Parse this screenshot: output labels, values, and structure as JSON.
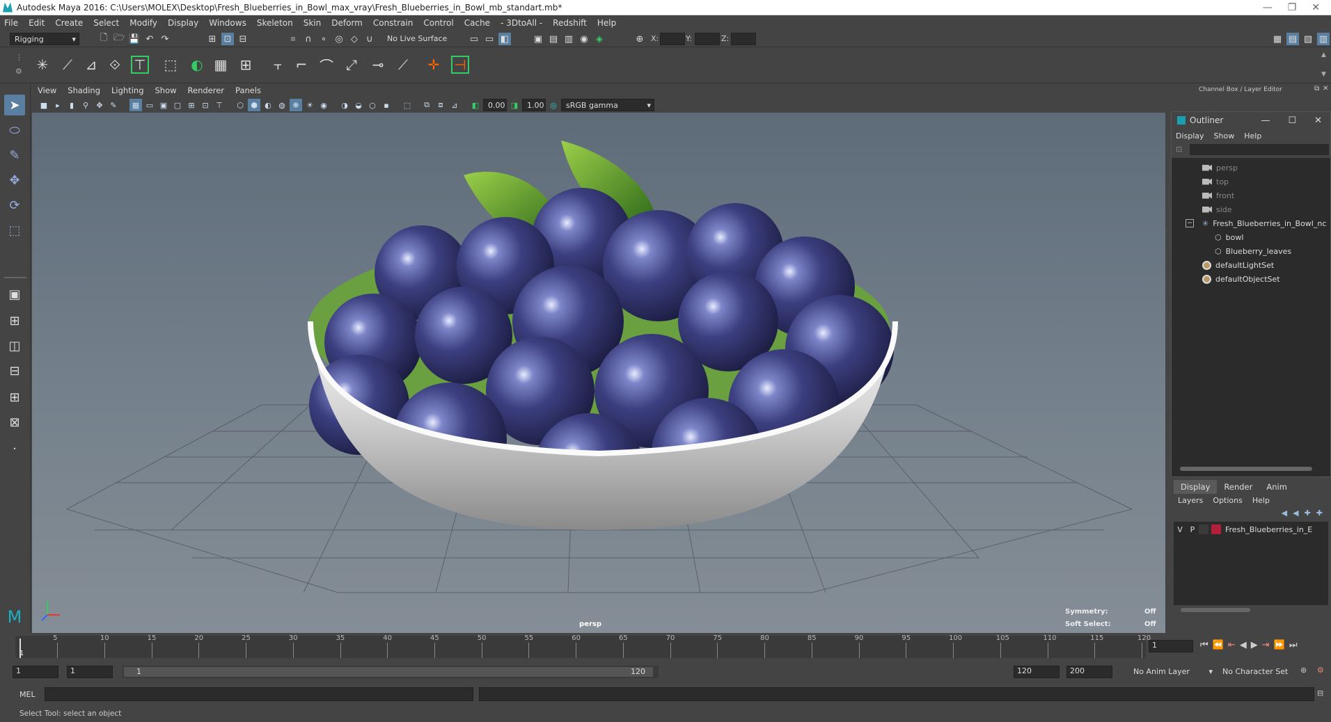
{
  "window": {
    "title": "Autodesk Maya 2016: C:\\Users\\MOLEX\\Desktop\\Fresh_Blueberries_in_Bowl_max_vray\\Fresh_Blueberries_in_Bowl_mb_standart.mb*"
  },
  "menu": [
    "File",
    "Edit",
    "Create",
    "Select",
    "Modify",
    "Display",
    "Windows",
    "Skeleton",
    "Skin",
    "Deform",
    "Constrain",
    "Control",
    "Cache",
    "- 3DtoAll -",
    "Redshift",
    "Help"
  ],
  "status": {
    "mode": "Rigging",
    "live_surface": "No Live Surface",
    "x_label": "X:",
    "y_label": "Y:",
    "z_label": "Z:"
  },
  "viewport": {
    "menu": [
      "View",
      "Shading",
      "Lighting",
      "Show",
      "Renderer",
      "Panels"
    ],
    "exposure": "0.00",
    "gamma": "1.00",
    "colorspace": "sRGB gamma",
    "camera_label": "persp",
    "symmetry_label": "Symmetry:",
    "symmetry_value": "Off",
    "softsel_label": "Soft Select:",
    "softsel_value": "Off"
  },
  "channel_box": {
    "title": "Channel Box / Layer Editor"
  },
  "outliner": {
    "title": "Outliner",
    "menu": [
      "Display",
      "Show",
      "Help"
    ],
    "items": [
      {
        "name": "persp",
        "type": "camera"
      },
      {
        "name": "top",
        "type": "camera"
      },
      {
        "name": "front",
        "type": "camera"
      },
      {
        "name": "side",
        "type": "camera"
      },
      {
        "name": "Fresh_Blueberries_in_Bowl_nc",
        "type": "group"
      },
      {
        "name": "bowl",
        "type": "mesh"
      },
      {
        "name": "Blueberry_leaves",
        "type": "mesh"
      },
      {
        "name": "defaultLightSet",
        "type": "set"
      },
      {
        "name": "defaultObjectSet",
        "type": "set"
      }
    ]
  },
  "layers": {
    "tabs": [
      "Display",
      "Render",
      "Anim"
    ],
    "menu": [
      "Layers",
      "Options",
      "Help"
    ],
    "row": {
      "v": "V",
      "p": "P",
      "color": "#b0203a",
      "name": "Fresh_Blueberries_in_E"
    }
  },
  "timeline": {
    "ticks": [
      "5",
      "10",
      "15",
      "20",
      "25",
      "30",
      "35",
      "40",
      "45",
      "50",
      "55",
      "60",
      "65",
      "70",
      "75",
      "80",
      "85",
      "90",
      "95",
      "100",
      "105",
      "110",
      "115",
      "120"
    ],
    "start": "1",
    "current": "1"
  },
  "range": {
    "start": "1",
    "playback_start": "1",
    "slider_start": "1",
    "slider_end": "120",
    "playback_end": "120",
    "end": "200",
    "anim_layer": "No Anim Layer",
    "char_set": "No Character Set"
  },
  "mel": {
    "label": "MEL"
  },
  "help_line": "Select Tool: select an object"
}
